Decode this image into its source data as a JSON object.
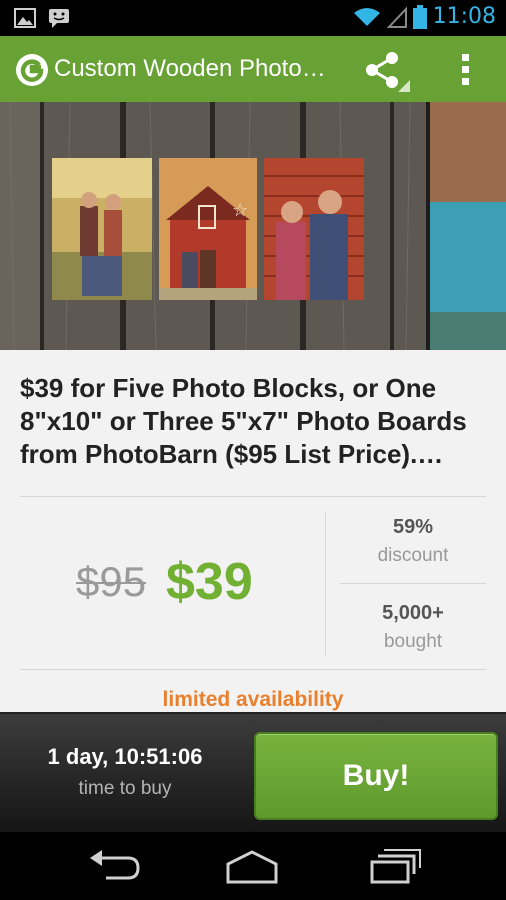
{
  "status_bar": {
    "time": "11:08",
    "icons": [
      "image-notification-icon",
      "chat-notification-icon",
      "wifi-icon",
      "signal-icon",
      "battery-icon"
    ]
  },
  "action_bar": {
    "logo_icon": "groupon-logo-icon",
    "title": "Custom Wooden Photo…",
    "share_icon": "share-icon",
    "overflow_icon": "overflow-menu-icon",
    "color": "#68a134"
  },
  "deal": {
    "title": "$39 for Five Photo Blocks, or One 8\"x10\" or Three 5\"x7\" Photo Boards from PhotoBarn ($95 List Price).…",
    "original_price": "$95",
    "price": "$39",
    "discount_value": "59%",
    "discount_label": "discount",
    "bought_value": "5,000+",
    "bought_label": "bought",
    "availability": "limited availability"
  },
  "purchase_bar": {
    "countdown": "1 day, 10:51:06",
    "countdown_label": "time to buy",
    "buy_label": "Buy!"
  },
  "nav_bar": {
    "buttons": [
      "back-icon",
      "home-icon",
      "recent-apps-icon"
    ]
  },
  "colors": {
    "accent_green": "#72b034",
    "availability_orange": "#e8802e",
    "clock_blue": "#33b5e5"
  }
}
